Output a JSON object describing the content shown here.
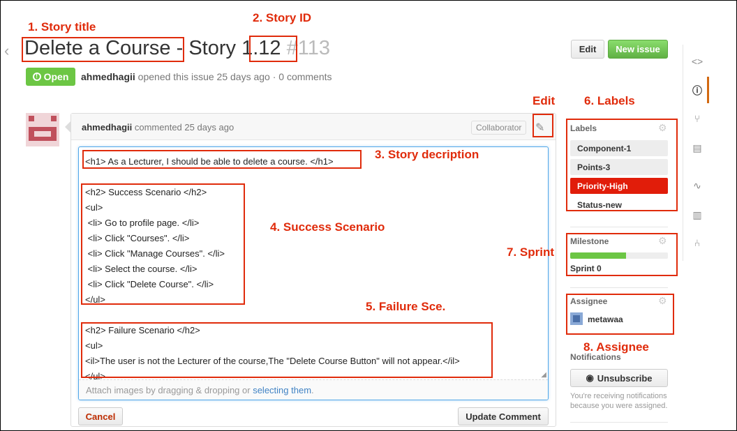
{
  "annotations": {
    "story_title": "1. Story title",
    "story_id": "2. Story ID",
    "story_description": "3. Story decription",
    "success": "4. Success Scenario",
    "failure": "5. Failure Sce.",
    "labels": "6. Labels",
    "sprint": "7. Sprint",
    "assignee": "8. Assignee",
    "edit": "Edit"
  },
  "header": {
    "title_name": "Delete a Course",
    "title_sep": " - Story ",
    "story_id": "1.12",
    "issue_number": "#113",
    "edit_label": "Edit",
    "new_issue_label": "New issue"
  },
  "status": {
    "badge": "Open",
    "author": "ahmedhagii",
    "meta_rest": " opened this issue 25 days ago · 0 comments"
  },
  "comment": {
    "author": "ahmedhagii",
    "meta": " commented 25 days ago",
    "role": "Collaborator",
    "lines": [
      "<h1> As a Lecturer, I should be able to delete a course. </h1>",
      "<h2> Success Scenario </h2>",
      "<ul>",
      " <li> Go to profile page. </li>",
      " <li> Click \"Courses\". </li>",
      " <li> Click \"Manage Courses\". </li>",
      " <li> Select the course. </li>",
      " <li> Click \"Delete Course\". </li>",
      "</ul>",
      "<h2> Failure Scenario </h2>",
      "<ul>",
      "<il>The user is not the Lecturer of the course,The \"Delete Course Button\" will not appear.</il>",
      "</ul>"
    ],
    "attach_text": "Attach images by dragging & dropping or ",
    "attach_link": "selecting them",
    "attach_end": ".",
    "cancel_label": "Cancel",
    "update_label": "Update Comment"
  },
  "sidebar": {
    "labels_title": "Labels",
    "labels": [
      {
        "name": "Component-1",
        "color": "#ededed"
      },
      {
        "name": "Points-3",
        "color": "#ededed"
      },
      {
        "name": "Priority-High",
        "color": "#e11d0a"
      },
      {
        "name": "Status-new",
        "color": "#ffffff"
      }
    ],
    "milestone_title": "Milestone",
    "milestone_progress": 0.57,
    "milestone_name": "Sprint 0",
    "assignee_title": "Assignee",
    "assignee_name": "metawaa",
    "notifications_title": "Notifications",
    "unsubscribe_label": "Unsubscribe",
    "notif_note": "You're receiving notifications because you were assigned."
  },
  "colors": {
    "annotation": "#e02b0b",
    "open": "#6cc644",
    "accent": "#d26911"
  }
}
